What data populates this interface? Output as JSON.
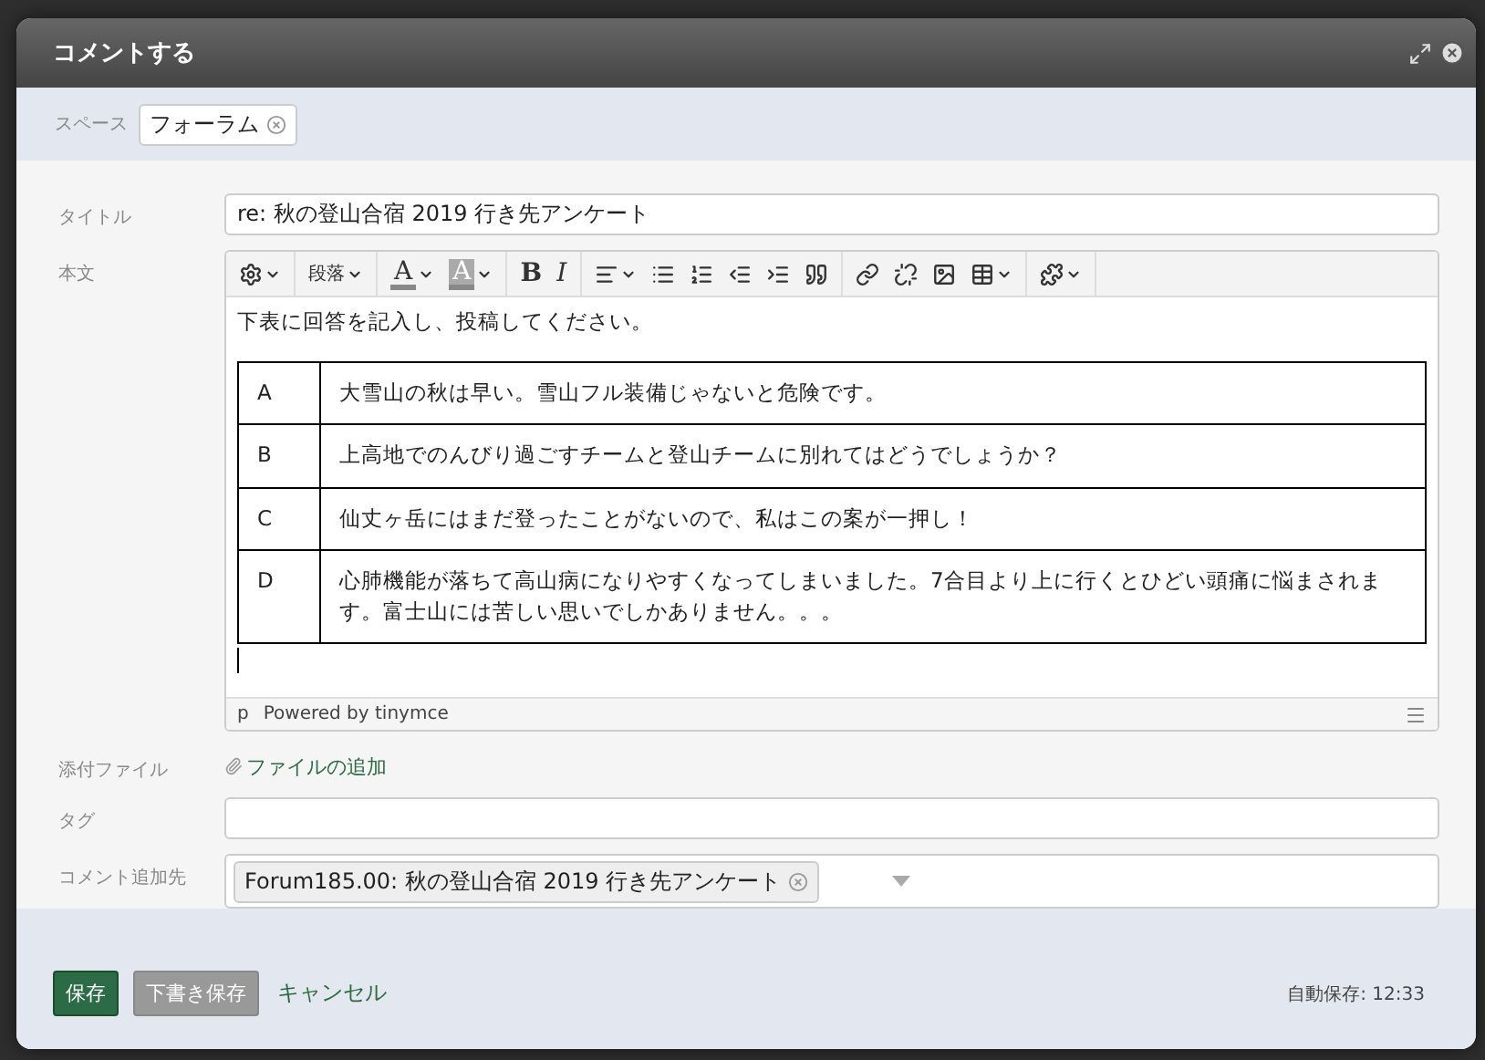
{
  "dialog": {
    "title": "コメントする"
  },
  "space": {
    "label": "スペース",
    "tag": "フォーラム"
  },
  "fields": {
    "title_label": "タイトル",
    "title_value": "re: 秋の登山合宿 2019 行き先アンケート",
    "body_label": "本文",
    "attach_label": "添付ファイル",
    "attach_link": "ファイルの追加",
    "tag_label": "タグ",
    "target_label": "コメント追加先",
    "target_tag": "Forum185.00: 秋の登山合宿 2019 行き先アンケート"
  },
  "toolbar": {
    "format": "段落",
    "text_color": "A",
    "background_color": "A",
    "bold": "B",
    "italic": "I"
  },
  "editor": {
    "intro": "下表に回答を記入し、投稿してください。",
    "rows": [
      {
        "key": "A",
        "text": "大雪山の秋は早い。雪山フル装備じゃないと危険です。"
      },
      {
        "key": "B",
        "text": "上高地でのんびり過ごすチームと登山チームに別れてはどうでしょうか？"
      },
      {
        "key": "C",
        "text": "仙丈ヶ岳にはまだ登ったことがないので、私はこの案が一押し！"
      },
      {
        "key": "D",
        "text": "心肺機能が落ちて高山病になりやすくなってしまいました。7合目より上に行くとひどい頭痛に悩まされます。富士山には苦しい思いでしかありません。。。"
      }
    ],
    "path": "p",
    "powered": "Powered by tinymce"
  },
  "footer": {
    "save": "保存",
    "draft": "下書き保存",
    "cancel": "キャンセル",
    "autosave": "自動保存: 12:33"
  }
}
